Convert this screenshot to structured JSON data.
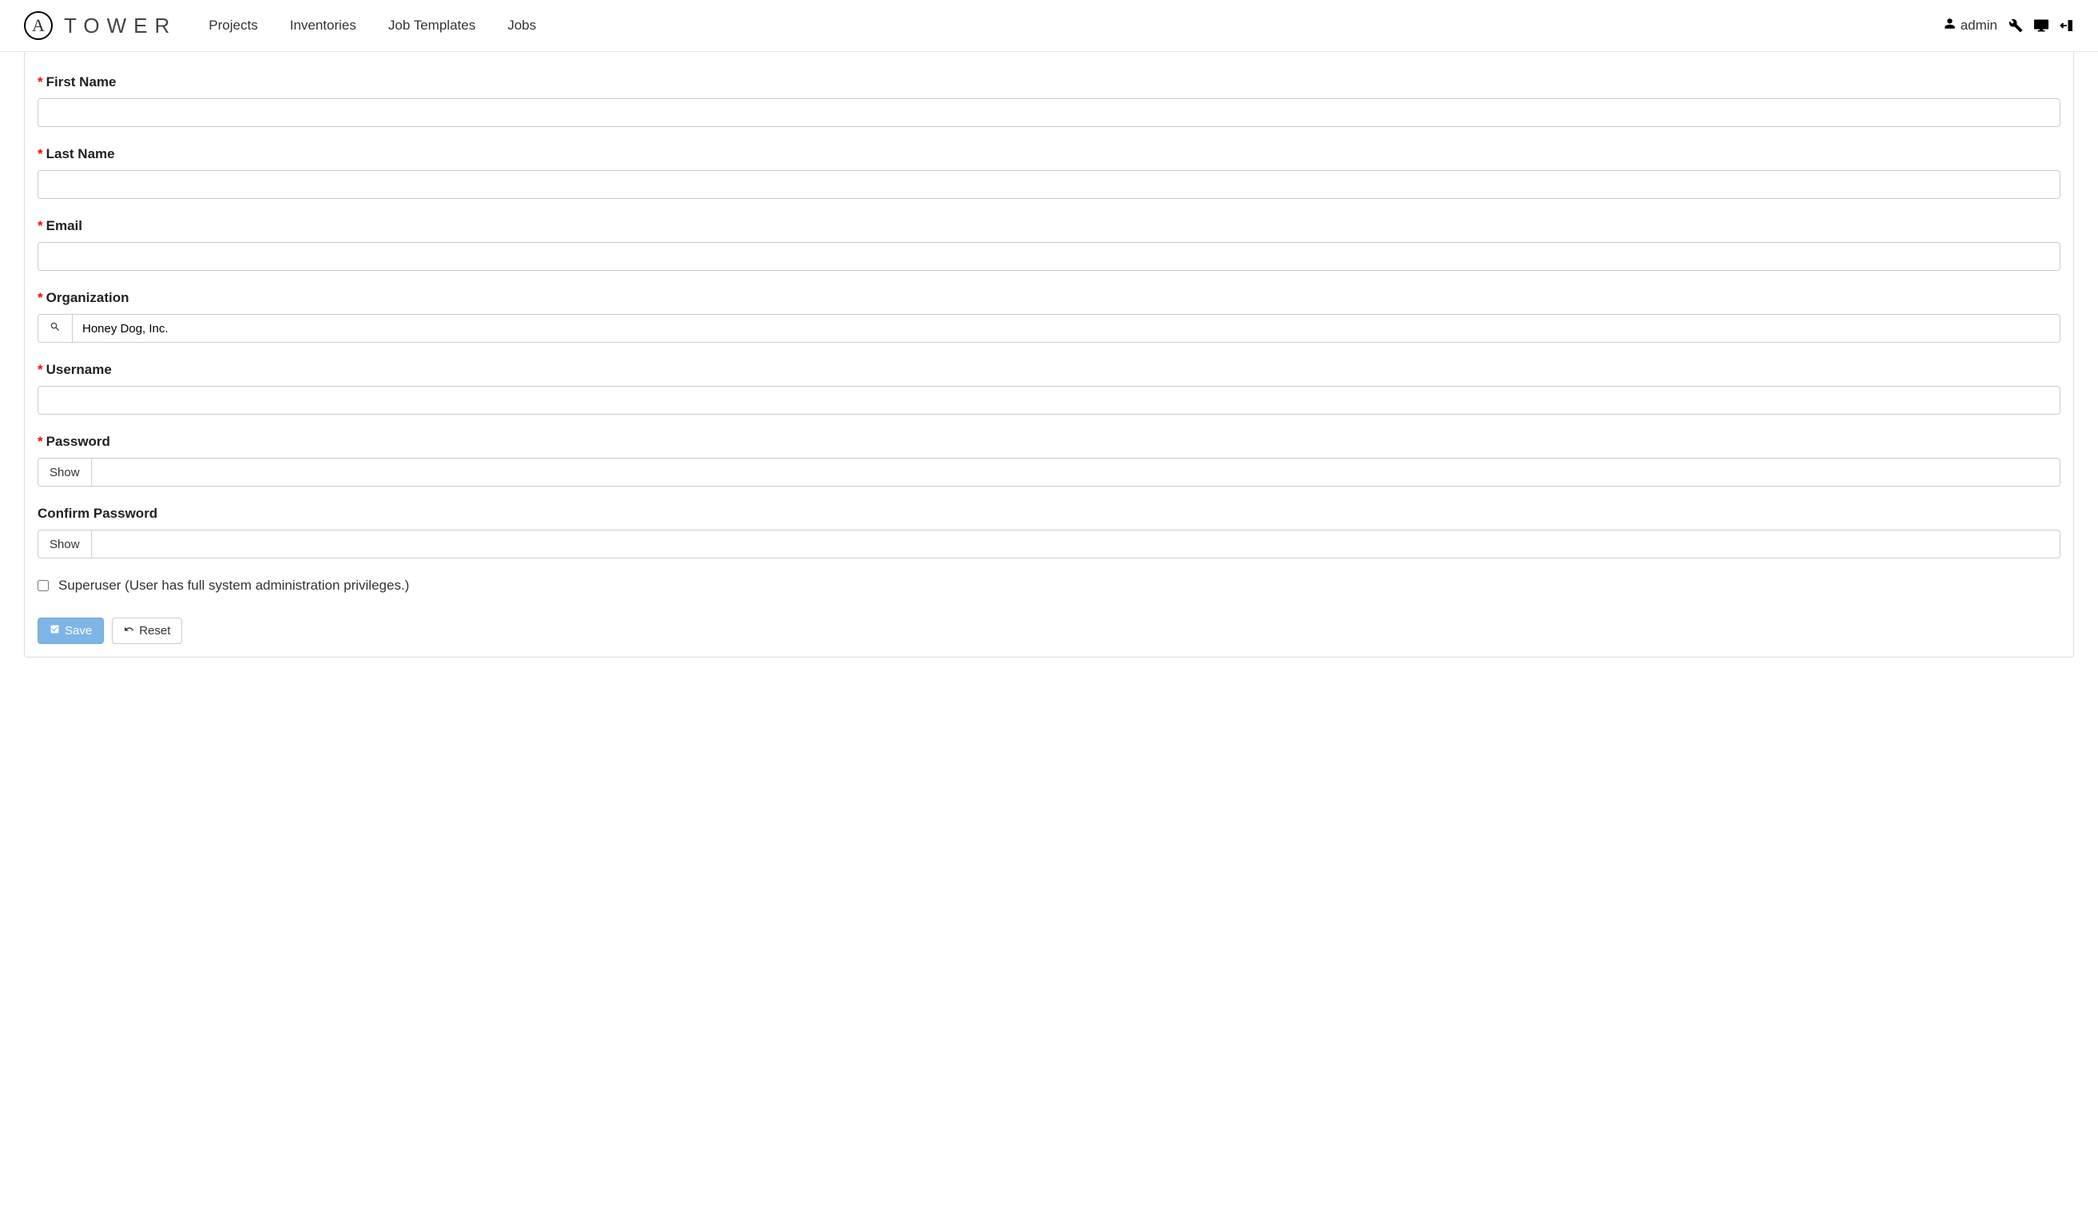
{
  "header": {
    "logo_letter": "A",
    "logo_text": "TOWER",
    "nav": {
      "projects": "Projects",
      "inventories": "Inventories",
      "job_templates": "Job Templates",
      "jobs": "Jobs"
    },
    "user": "admin"
  },
  "form": {
    "first_name": {
      "label": "First Name",
      "value": "",
      "required": true
    },
    "last_name": {
      "label": "Last Name",
      "value": "",
      "required": true
    },
    "email": {
      "label": "Email",
      "value": "",
      "required": true
    },
    "organization": {
      "label": "Organization",
      "value": "Honey Dog, Inc.",
      "required": true
    },
    "username": {
      "label": "Username",
      "value": "",
      "required": true
    },
    "password": {
      "label": "Password",
      "show_label": "Show",
      "value": "",
      "required": true
    },
    "confirm_password": {
      "label": "Confirm Password",
      "show_label": "Show",
      "value": "",
      "required": false
    },
    "superuser": {
      "label": "Superuser  (User has full system administration privileges.)",
      "checked": false
    }
  },
  "buttons": {
    "save": "Save",
    "reset": "Reset"
  }
}
